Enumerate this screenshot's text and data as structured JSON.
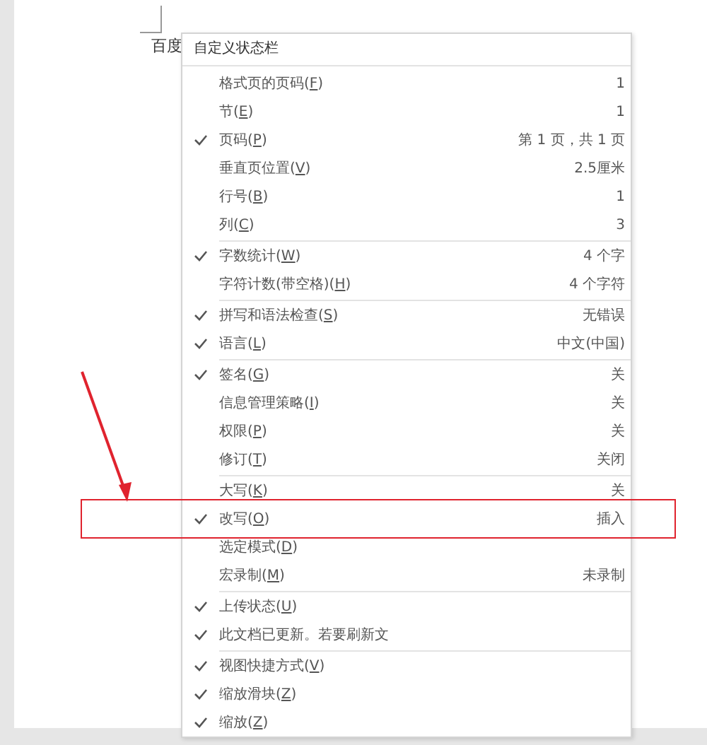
{
  "document": {
    "text": "百度"
  },
  "menu": {
    "title": "自定义状态栏",
    "groups": [
      [
        {
          "pre": "格式页的页码(",
          "key": "F",
          "post": ")",
          "value": "1",
          "checked": false,
          "annotated": false
        },
        {
          "pre": "节(",
          "key": "E",
          "post": ")",
          "value": "1",
          "checked": false,
          "annotated": false
        },
        {
          "pre": "页码(",
          "key": "P",
          "post": ")",
          "value": "第 1 页，共 1 页",
          "checked": true,
          "annotated": false
        },
        {
          "pre": "垂直页位置(",
          "key": "V",
          "post": ")",
          "value": "2.5厘米",
          "checked": false,
          "annotated": false
        },
        {
          "pre": "行号(",
          "key": "B",
          "post": ")",
          "value": "1",
          "checked": false,
          "annotated": false
        },
        {
          "pre": "列(",
          "key": "C",
          "post": ")",
          "value": "3",
          "checked": false,
          "annotated": false
        }
      ],
      [
        {
          "pre": "字数统计(",
          "key": "W",
          "post": ")",
          "value": "4 个字",
          "checked": true,
          "annotated": false
        },
        {
          "pre": "字符计数(带空格)(",
          "key": "H",
          "post": ")",
          "value": "4 个字符",
          "checked": false,
          "annotated": false
        }
      ],
      [
        {
          "pre": "拼写和语法检查(",
          "key": "S",
          "post": ")",
          "value": "无错误",
          "checked": true,
          "annotated": false
        },
        {
          "pre": "语言(",
          "key": "L",
          "post": ")",
          "value": "中文(中国)",
          "checked": true,
          "annotated": false
        }
      ],
      [
        {
          "pre": "签名(",
          "key": "G",
          "post": ")",
          "value": "关",
          "checked": true,
          "annotated": false
        },
        {
          "pre": "信息管理策略(",
          "key": "I",
          "post": ")",
          "value": "关",
          "checked": false,
          "annotated": false
        },
        {
          "pre": "权限(",
          "key": "P",
          "post": ")",
          "value": "关",
          "checked": false,
          "annotated": false
        },
        {
          "pre": "修订(",
          "key": "T",
          "post": ")",
          "value": "关闭",
          "checked": false,
          "annotated": false
        }
      ],
      [
        {
          "pre": "大写(",
          "key": "K",
          "post": ")",
          "value": "关",
          "checked": false,
          "annotated": false
        },
        {
          "pre": "改写(",
          "key": "O",
          "post": ")",
          "value": "插入",
          "checked": true,
          "annotated": true
        },
        {
          "pre": "选定模式(",
          "key": "D",
          "post": ")",
          "checked": false,
          "annotated": false
        },
        {
          "pre": "宏录制(",
          "key": "M",
          "post": ")",
          "value": "未录制",
          "checked": false,
          "annotated": false
        }
      ],
      [
        {
          "pre": "上传状态(",
          "key": "U",
          "post": ")",
          "checked": true,
          "annotated": false
        },
        {
          "pre": "此文档已更新。若要刷新文",
          "checked": true,
          "annotated": false
        }
      ],
      [
        {
          "pre": "视图快捷方式(",
          "key": "V",
          "post": ")",
          "checked": true,
          "annotated": false
        },
        {
          "pre": "缩放滑块(",
          "key": "Z",
          "post": ")",
          "checked": true,
          "annotated": false
        },
        {
          "pre": "缩放(",
          "key": "Z",
          "post": ")",
          "checked": true,
          "annotated": false
        }
      ]
    ]
  }
}
